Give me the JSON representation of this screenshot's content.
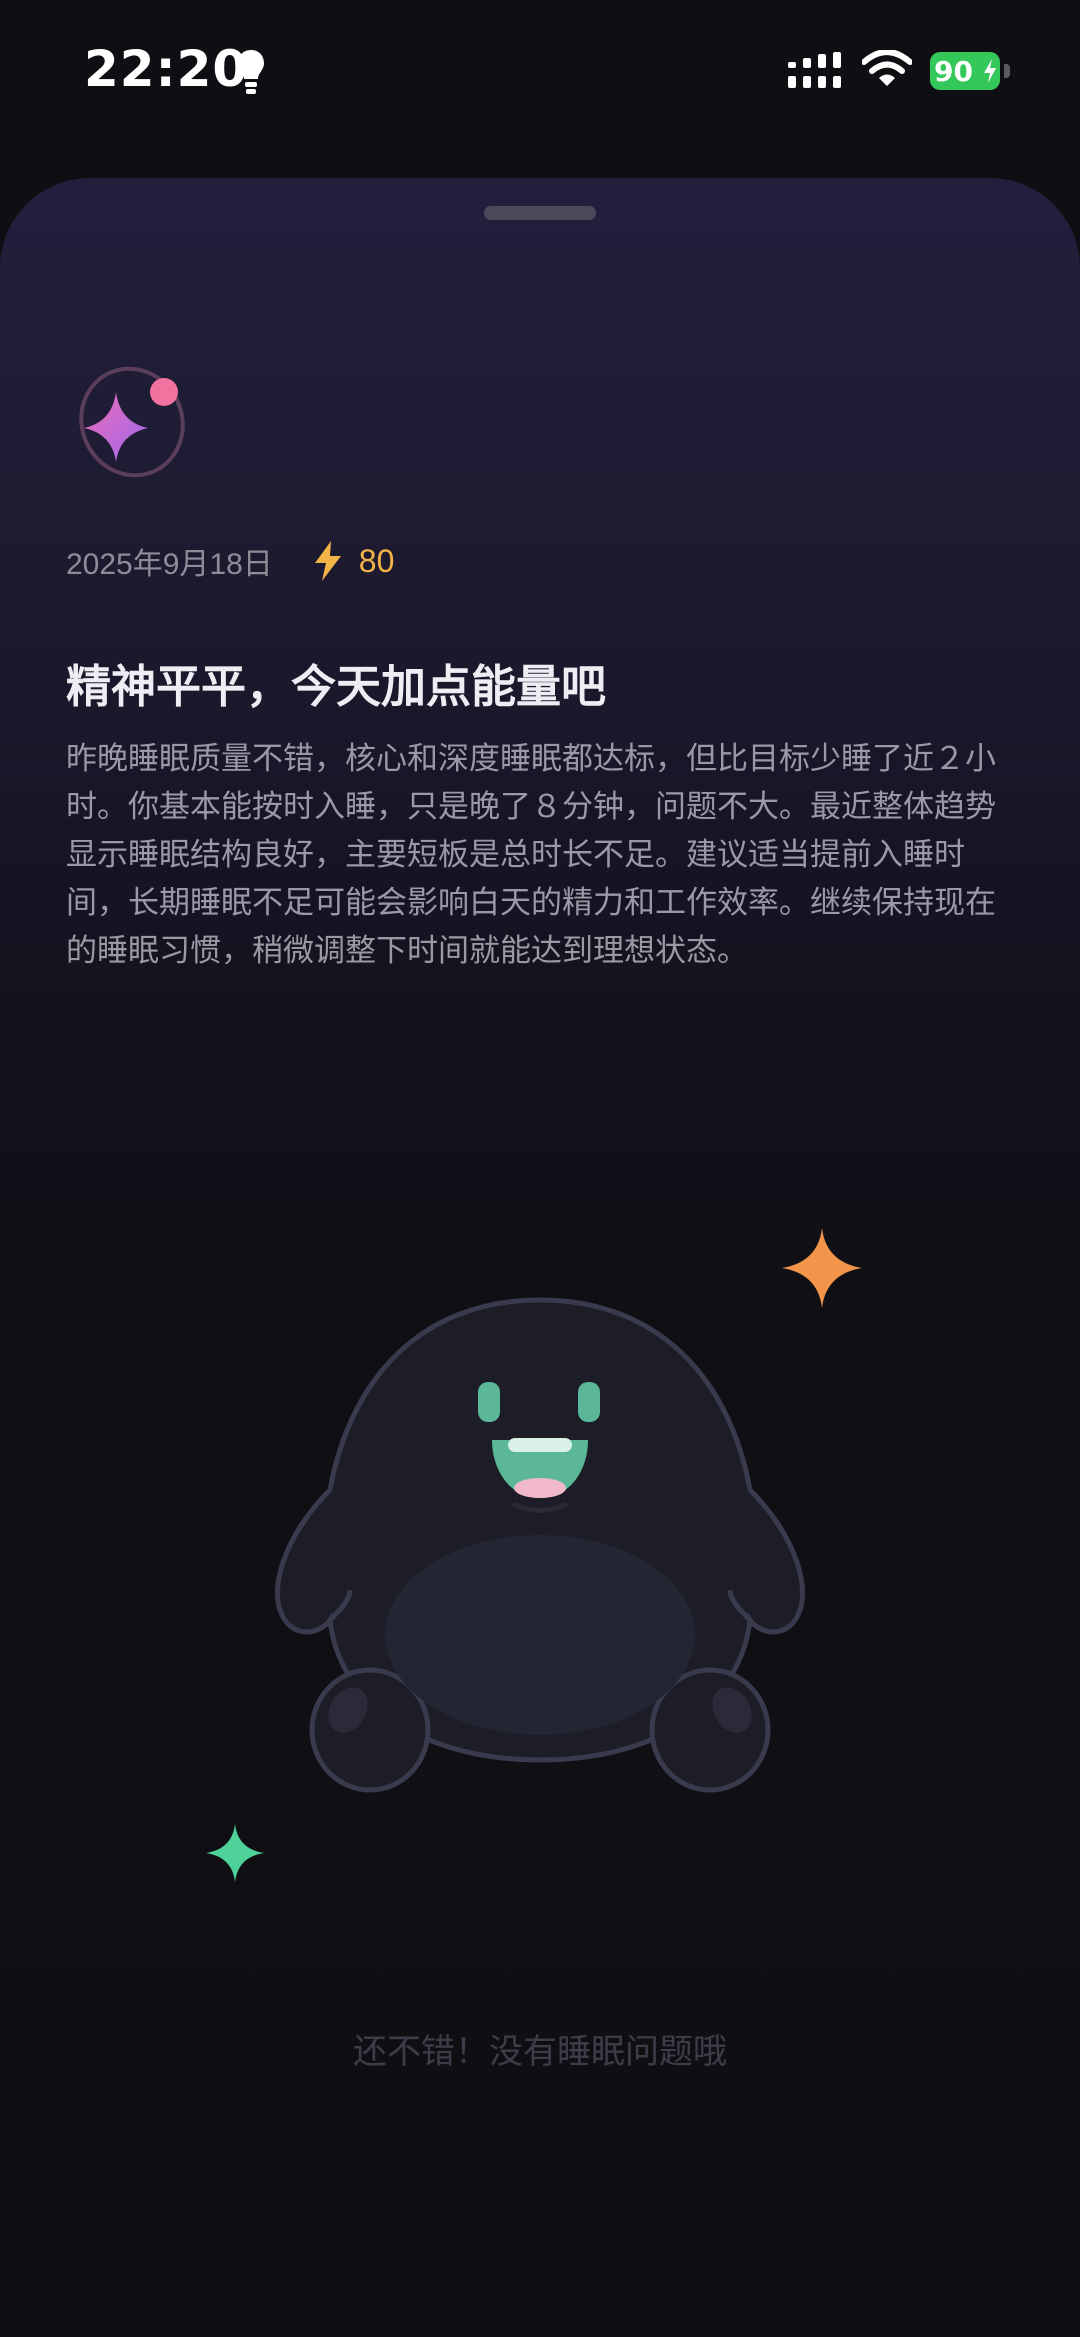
{
  "status_bar": {
    "time": "22:20",
    "battery": "90",
    "icons": [
      "lightbulb-icon",
      "signal-icon",
      "wifi-icon",
      "battery-charging-icon"
    ]
  },
  "report": {
    "date": "2025年9月18日",
    "energy_score": "80",
    "title": "精神平平，今天加点能量吧",
    "description": "昨晚睡眠质量不错，核心和深度睡眠都达标，但比目标少睡了近２小时。你基本能按时入睡，只是晚了８分钟，问题不大。最近整体趋势显示睡眠结构良好，主要短板是总时长不足。建议适当提前入睡时间，长期睡眠不足可能会影响白天的精力和工作效率。继续保持现在的睡眠习惯，稍微调整下时间就能达到理想状态。",
    "footer_message": "还不错！没有睡眠问题哦"
  },
  "colors": {
    "accent_energy": "#f2b347",
    "battery": "#34c759",
    "spark_orange": "#f2954a",
    "spark_green": "#4fd19a",
    "mascot_mouth": "#5bb797"
  }
}
